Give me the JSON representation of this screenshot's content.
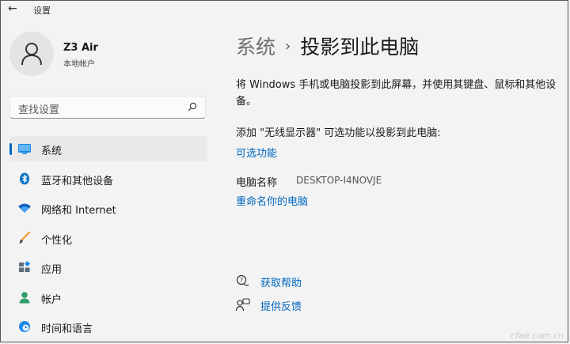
{
  "titlebar": {
    "back_glyph": "←",
    "title": "设置"
  },
  "user": {
    "name": "Z3 Air",
    "account_type": "本地帐户"
  },
  "search": {
    "placeholder": "查找设置"
  },
  "sidebar": {
    "items": [
      {
        "label": "系统",
        "icon": "monitor-icon",
        "active": true
      },
      {
        "label": "蓝牙和其他设备",
        "icon": "bluetooth-icon"
      },
      {
        "label": "网络和 Internet",
        "icon": "wifi-icon"
      },
      {
        "label": "个性化",
        "icon": "brush-icon"
      },
      {
        "label": "应用",
        "icon": "apps-icon"
      },
      {
        "label": "帐户",
        "icon": "person-icon"
      },
      {
        "label": "时间和语言",
        "icon": "globe-clock-icon"
      }
    ]
  },
  "breadcrumb": {
    "root": "系统",
    "separator": "›",
    "current": "投影到此电脑"
  },
  "main": {
    "description": "将 Windows 手机或电脑投影到此屏幕，并使用其键盘、鼠标和其他设备。",
    "add_feature_text": "添加 \"无线显示器\" 可选功能以投影到此电脑:",
    "optional_features_link": "可选功能",
    "pc_name_label": "电脑名称",
    "pc_name_value": "DESKTOP-I4NOVJE",
    "rename_link": "重命名你的电脑",
    "get_help_link": "获取帮助",
    "feedback_link": "提供反馈"
  },
  "watermark": "cfan.com.cn",
  "colors": {
    "accent": "#0067c0",
    "background": "#f3f3f3",
    "selected": "#e9e9e9"
  }
}
